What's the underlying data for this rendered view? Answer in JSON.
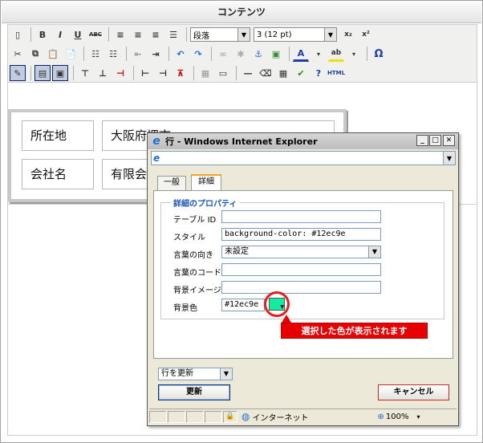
{
  "header": {
    "title": "コンテンツ"
  },
  "toolbar": {
    "format_select": "段落",
    "size_select": "3 (12 pt)",
    "buttons": {
      "bold": "B",
      "italic": "I",
      "underline": "U",
      "strike": "ABC",
      "subscript": "x₂",
      "superscript": "x²",
      "omega": "Ω",
      "html": "HTML"
    }
  },
  "editor": {
    "table": [
      {
        "label": "所在地",
        "value": "大阪府堺市"
      },
      {
        "label": "会社名",
        "value": "有限会社"
      }
    ]
  },
  "dialog": {
    "window_title": "行 - Windows Internet Explorer",
    "tabs": [
      "一般",
      "詳細"
    ],
    "legend": "詳細のプロパティ",
    "fields": {
      "table_id_label": "テーブル ID",
      "table_id_value": "",
      "style_label": "スタイル",
      "style_value": "background-color: #12ec9e",
      "direction_label": "言葉の向き",
      "direction_value": "未設定",
      "lang_code_label": "言葉のコード",
      "lang_code_value": "",
      "bg_image_label": "背景イメージ",
      "bg_image_value": "",
      "bg_color_label": "背景色",
      "bg_color_value": "#12ec9e"
    },
    "callout": "選択した色が表示されます",
    "action_select": "行を更新",
    "update_button": "更新",
    "cancel_button": "キャンセル",
    "status": {
      "zone": "インターネット",
      "zoom": "100%"
    }
  },
  "colors": {
    "selected_bg": "#12ec9e",
    "callout": "#e60000",
    "ie_blue": "#1d6fd6"
  }
}
